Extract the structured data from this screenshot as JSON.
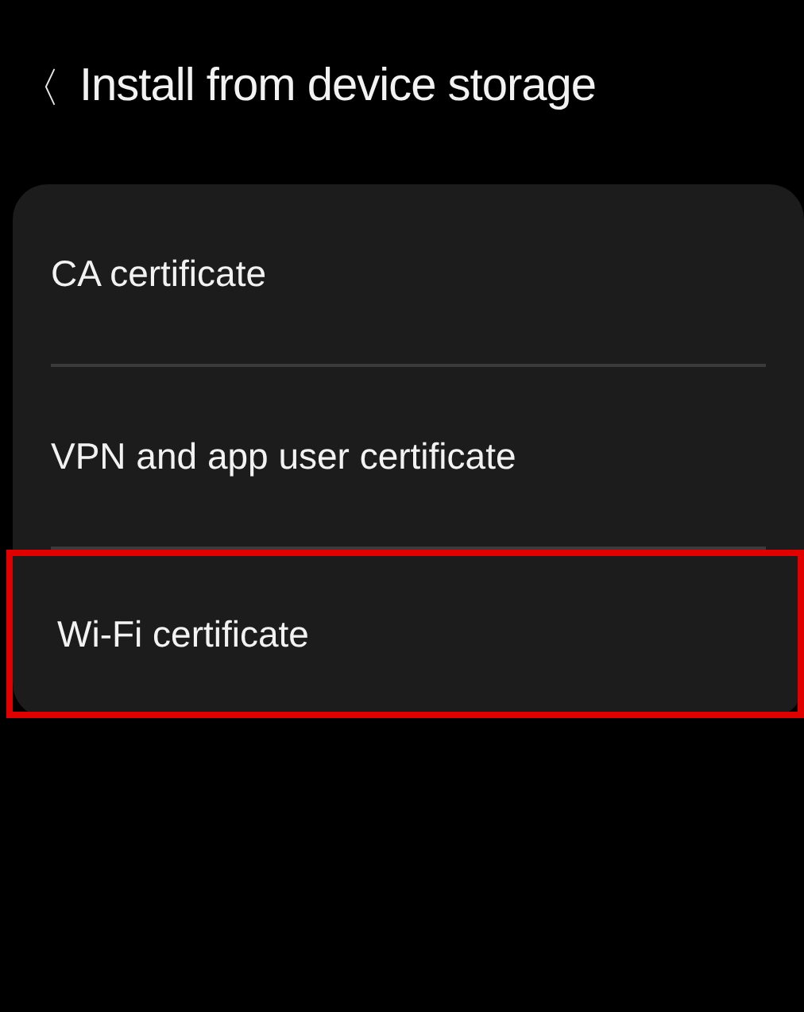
{
  "header": {
    "back": "〈",
    "title": "Install from device storage"
  },
  "items": [
    {
      "label": "CA certificate",
      "highlighted": false
    },
    {
      "label": "VPN and app user certificate",
      "highlighted": false
    },
    {
      "label": "Wi-Fi certificate",
      "highlighted": true
    }
  ]
}
